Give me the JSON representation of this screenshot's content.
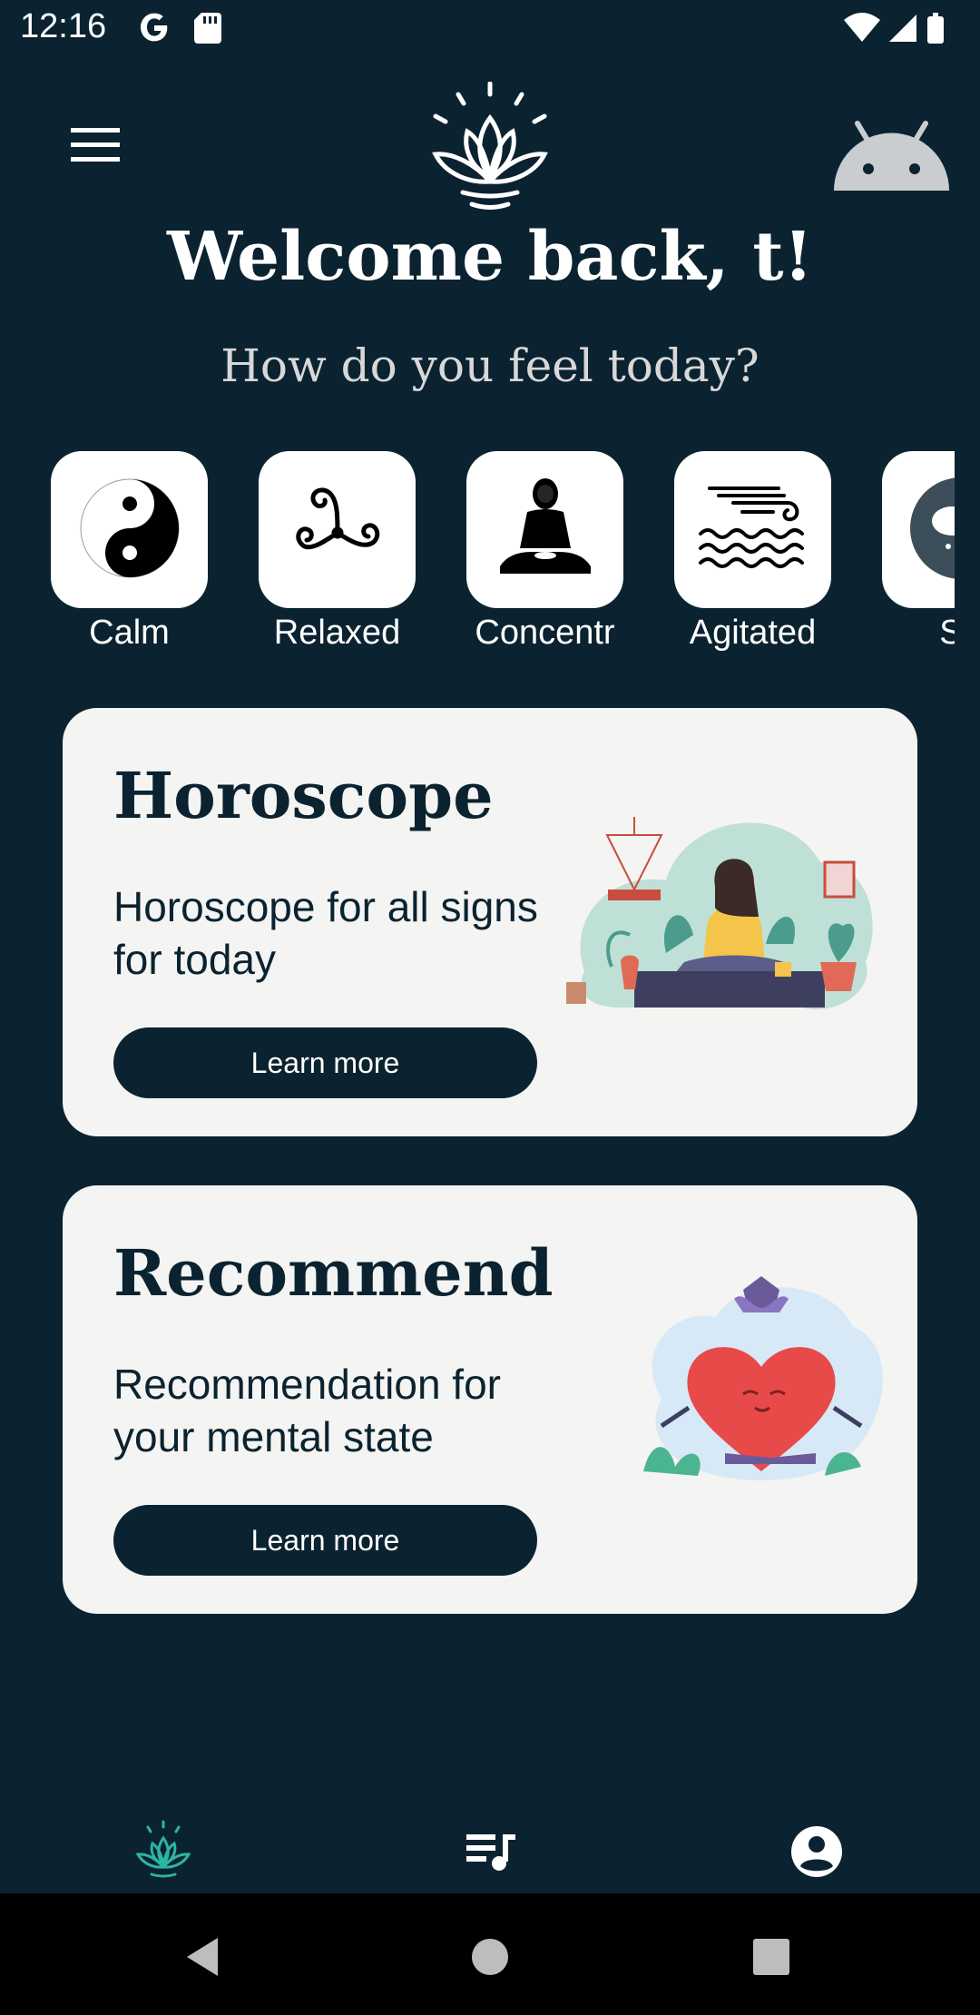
{
  "status_bar": {
    "time": "12:16",
    "icons": [
      "google-icon",
      "sd-card-icon",
      "wifi-icon",
      "signal-icon",
      "battery-icon"
    ]
  },
  "header": {
    "menu_icon": "hamburger-menu-icon",
    "logo_icon": "lotus-logo-icon",
    "avatar_icon": "android-avatar-icon",
    "welcome": "Welcome back, t!",
    "subtitle": "How do you feel today?"
  },
  "moods": [
    {
      "label": "Calm",
      "icon": "yin-yang-icon"
    },
    {
      "label": "Relaxed",
      "icon": "triskelion-icon"
    },
    {
      "label": "Concentr",
      "icon": "buddha-icon"
    },
    {
      "label": "Agitated",
      "icon": "wind-waves-icon"
    },
    {
      "label": "Sa",
      "icon": "rain-cloud-icon"
    }
  ],
  "cards": [
    {
      "title": "Horoscope",
      "description": "Horoscope for all signs for today",
      "button": "Learn more",
      "illustration": "meditating-woman-illustration"
    },
    {
      "title": "Recommend",
      "description": "Recommendation for your mental state",
      "button": "Learn more",
      "illustration": "meditating-heart-illustration"
    }
  ],
  "bottom_nav": [
    {
      "icon": "lotus-icon",
      "active": true
    },
    {
      "icon": "playlist-icon",
      "active": false
    },
    {
      "icon": "account-icon",
      "active": false
    }
  ],
  "system_nav": [
    "back-icon",
    "home-icon",
    "recents-icon"
  ],
  "colors": {
    "background": "#0b2330",
    "card": "#f4f4f3",
    "accent_active": "#2bb5a3",
    "text_light": "#ffffff"
  }
}
